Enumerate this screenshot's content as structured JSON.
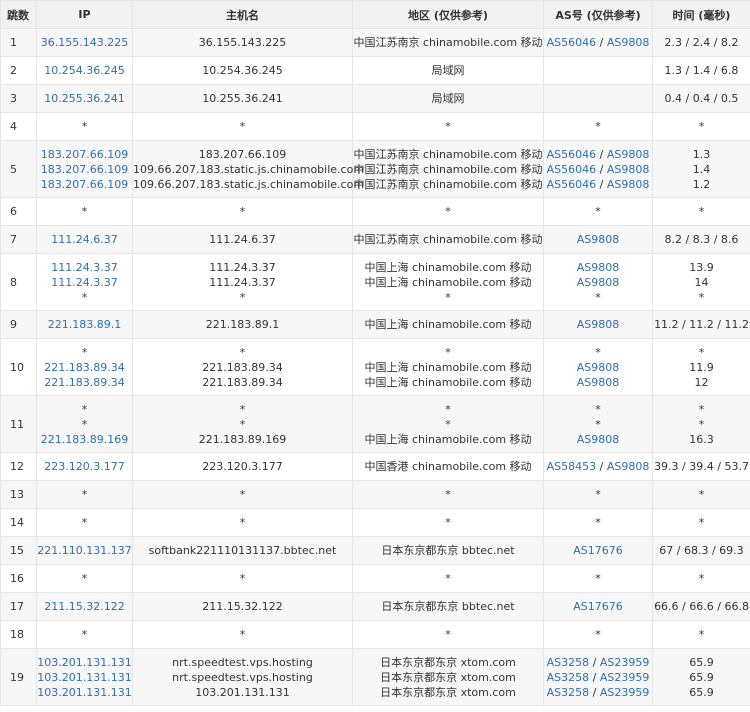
{
  "headers": {
    "hop": "跳数",
    "ip": "IP",
    "host": "主机名",
    "region": "地区 (仅供参考)",
    "as": "AS号 (仅供参考)",
    "time": "时间 (毫秒)"
  },
  "rows": [
    {
      "hop": "1",
      "lines": [
        {
          "ip": "36.155.143.225",
          "host": "36.155.143.225",
          "region": "中国江苏南京 chinamobile.com 移动",
          "as": [
            "AS56046",
            "AS9808"
          ],
          "time": "2.3 / 2.4 / 8.2"
        }
      ]
    },
    {
      "hop": "2",
      "lines": [
        {
          "ip": "10.254.36.245",
          "host": "10.254.36.245",
          "region": "局域网",
          "as": [],
          "time": "1.3 / 1.4 / 6.8"
        }
      ]
    },
    {
      "hop": "3",
      "lines": [
        {
          "ip": "10.255.36.241",
          "host": "10.255.36.241",
          "region": "局域网",
          "as": [],
          "time": "0.4 / 0.4 / 0.5"
        }
      ]
    },
    {
      "hop": "4",
      "lines": [
        {
          "ip": "*",
          "host": "*",
          "region": "*",
          "as": [
            "*"
          ],
          "time": "*"
        }
      ]
    },
    {
      "hop": "5",
      "lines": [
        {
          "ip": "183.207.66.109",
          "host": "183.207.66.109",
          "region": "中国江苏南京 chinamobile.com 移动",
          "as": [
            "AS56046",
            "AS9808"
          ],
          "time": "1.3"
        },
        {
          "ip": "183.207.66.109",
          "host": "109.66.207.183.static.js.chinamobile.com",
          "region": "中国江苏南京 chinamobile.com 移动",
          "as": [
            "AS56046",
            "AS9808"
          ],
          "time": "1.4"
        },
        {
          "ip": "183.207.66.109",
          "host": "109.66.207.183.static.js.chinamobile.com",
          "region": "中国江苏南京 chinamobile.com 移动",
          "as": [
            "AS56046",
            "AS9808"
          ],
          "time": "1.2"
        }
      ]
    },
    {
      "hop": "6",
      "lines": [
        {
          "ip": "*",
          "host": "*",
          "region": "*",
          "as": [
            "*"
          ],
          "time": "*"
        }
      ]
    },
    {
      "hop": "7",
      "lines": [
        {
          "ip": "111.24.6.37",
          "host": "111.24.6.37",
          "region": "中国江苏南京 chinamobile.com 移动",
          "as": [
            "AS9808"
          ],
          "time": "8.2 / 8.3 / 8.6"
        }
      ]
    },
    {
      "hop": "8",
      "lines": [
        {
          "ip": "111.24.3.37",
          "host": "111.24.3.37",
          "region": "中国上海 chinamobile.com 移动",
          "as": [
            "AS9808"
          ],
          "time": "13.9"
        },
        {
          "ip": "111.24.3.37",
          "host": "111.24.3.37",
          "region": "中国上海 chinamobile.com 移动",
          "as": [
            "AS9808"
          ],
          "time": "14"
        },
        {
          "ip": "*",
          "host": "*",
          "region": "*",
          "as": [
            "*"
          ],
          "time": "*"
        }
      ]
    },
    {
      "hop": "9",
      "lines": [
        {
          "ip": "221.183.89.1",
          "host": "221.183.89.1",
          "region": "中国上海 chinamobile.com 移动",
          "as": [
            "AS9808"
          ],
          "time": "11.2 / 11.2 / 11.2"
        }
      ]
    },
    {
      "hop": "10",
      "lines": [
        {
          "ip": "*",
          "host": "*",
          "region": "*",
          "as": [
            "*"
          ],
          "time": "*"
        },
        {
          "ip": "221.183.89.34",
          "host": "221.183.89.34",
          "region": "中国上海 chinamobile.com 移动",
          "as": [
            "AS9808"
          ],
          "time": "11.9"
        },
        {
          "ip": "221.183.89.34",
          "host": "221.183.89.34",
          "region": "中国上海 chinamobile.com 移动",
          "as": [
            "AS9808"
          ],
          "time": "12"
        }
      ]
    },
    {
      "hop": "11",
      "lines": [
        {
          "ip": "*",
          "host": "*",
          "region": "*",
          "as": [
            "*"
          ],
          "time": "*"
        },
        {
          "ip": "*",
          "host": "*",
          "region": "*",
          "as": [
            "*"
          ],
          "time": "*"
        },
        {
          "ip": "221.183.89.169",
          "host": "221.183.89.169",
          "region": "中国上海 chinamobile.com 移动",
          "as": [
            "AS9808"
          ],
          "time": "16.3"
        }
      ]
    },
    {
      "hop": "12",
      "lines": [
        {
          "ip": "223.120.3.177",
          "host": "223.120.3.177",
          "region": "中国香港 chinamobile.com 移动",
          "as": [
            "AS58453",
            "AS9808"
          ],
          "time": "39.3 / 39.4 / 53.7"
        }
      ]
    },
    {
      "hop": "13",
      "lines": [
        {
          "ip": "*",
          "host": "*",
          "region": "*",
          "as": [
            "*"
          ],
          "time": "*"
        }
      ]
    },
    {
      "hop": "14",
      "lines": [
        {
          "ip": "*",
          "host": "*",
          "region": "*",
          "as": [
            "*"
          ],
          "time": "*"
        }
      ]
    },
    {
      "hop": "15",
      "lines": [
        {
          "ip": "221.110.131.137",
          "host": "softbank221110131137.bbtec.net",
          "region": "日本东京都东京 bbtec.net",
          "as": [
            "AS17676"
          ],
          "time": "67 / 68.3 / 69.3"
        }
      ]
    },
    {
      "hop": "16",
      "lines": [
        {
          "ip": "*",
          "host": "*",
          "region": "*",
          "as": [
            "*"
          ],
          "time": "*"
        }
      ]
    },
    {
      "hop": "17",
      "lines": [
        {
          "ip": "211.15.32.122",
          "host": "211.15.32.122",
          "region": "日本东京都东京 bbtec.net",
          "as": [
            "AS17676"
          ],
          "time": "66.6 / 66.6 / 66.8"
        }
      ]
    },
    {
      "hop": "18",
      "lines": [
        {
          "ip": "*",
          "host": "*",
          "region": "*",
          "as": [
            "*"
          ],
          "time": "*"
        }
      ]
    },
    {
      "hop": "19",
      "lines": [
        {
          "ip": "103.201.131.131",
          "host": "nrt.speedtest.vps.hosting",
          "region": "日本东京都东京 xtom.com",
          "as": [
            "AS3258",
            "AS23959"
          ],
          "time": "65.9"
        },
        {
          "ip": "103.201.131.131",
          "host": "nrt.speedtest.vps.hosting",
          "region": "日本东京都东京 xtom.com",
          "as": [
            "AS3258",
            "AS23959"
          ],
          "time": "65.9"
        },
        {
          "ip": "103.201.131.131",
          "host": "103.201.131.131",
          "region": "日本东京都东京 xtom.com",
          "as": [
            "AS3258",
            "AS23959"
          ],
          "time": "65.9"
        }
      ]
    }
  ]
}
